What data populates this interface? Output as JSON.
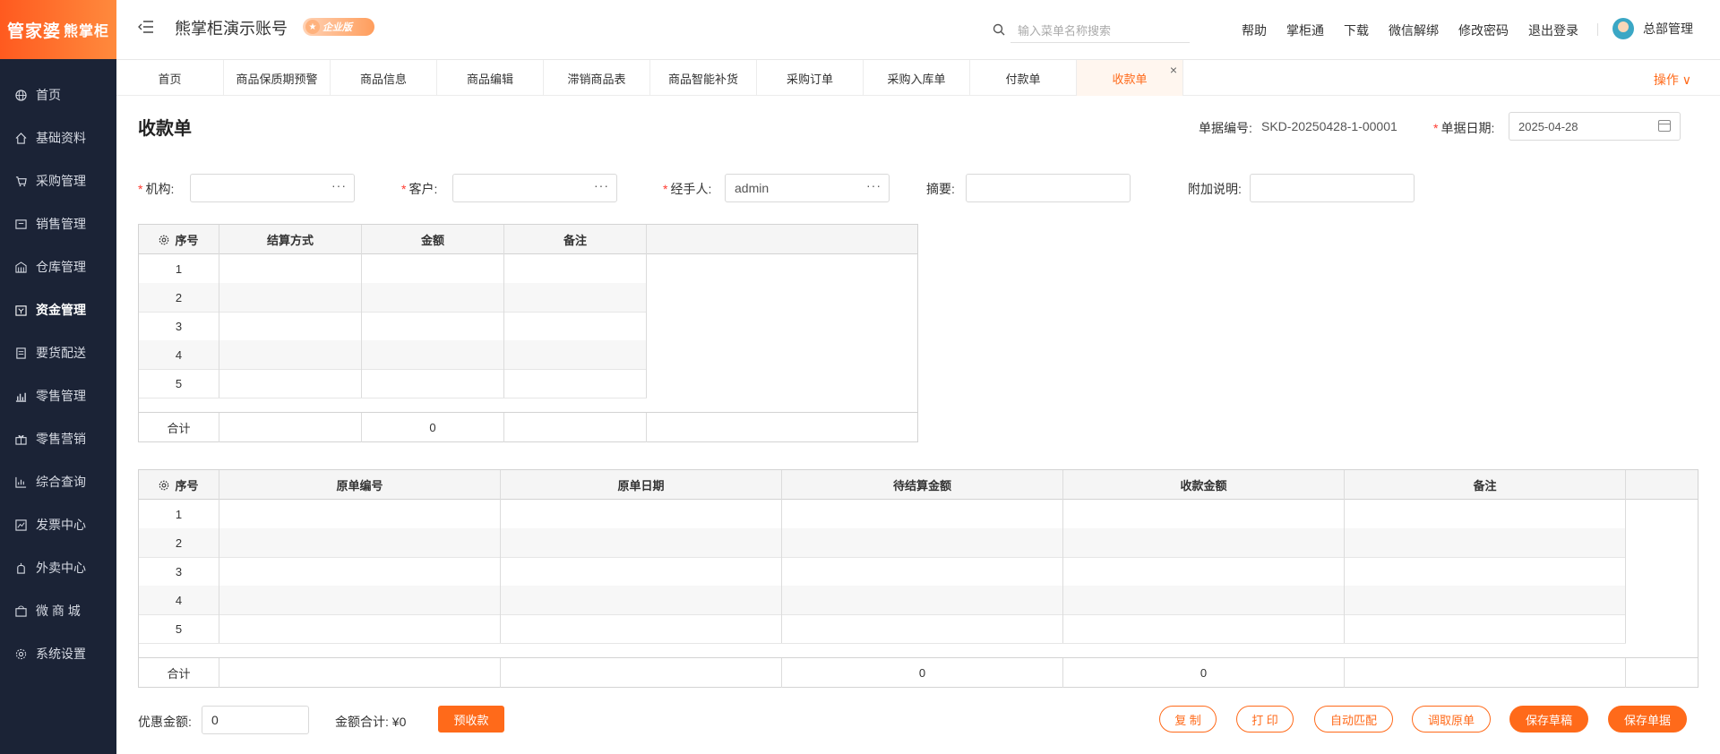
{
  "sidebar": {
    "logo_main": "管家婆",
    "logo_sub": "熊掌柜",
    "items": [
      {
        "label": "首页",
        "icon": "globe-icon"
      },
      {
        "label": "基础资料",
        "icon": "home-icon"
      },
      {
        "label": "采购管理",
        "icon": "cart-icon"
      },
      {
        "label": "销售管理",
        "icon": "sales-icon"
      },
      {
        "label": "仓库管理",
        "icon": "warehouse-icon"
      },
      {
        "label": "资金管理",
        "icon": "finance-icon"
      },
      {
        "label": "要货配送",
        "icon": "delivery-icon"
      },
      {
        "label": "零售管理",
        "icon": "retail-icon"
      },
      {
        "label": "零售营销",
        "icon": "gift-icon"
      },
      {
        "label": "综合查询",
        "icon": "chart-icon"
      },
      {
        "label": "发票中心",
        "icon": "invoice-icon"
      },
      {
        "label": "外卖中心",
        "icon": "takeout-icon"
      },
      {
        "label": "微 商 城",
        "icon": "shop-icon"
      },
      {
        "label": "系统设置",
        "icon": "gear-icon"
      }
    ],
    "active": "资金管理"
  },
  "header": {
    "account": "熊掌柜演示账号",
    "edition": "企业版",
    "search_placeholder": "输入菜单名称搜索",
    "links": [
      "帮助",
      "掌柜通",
      "下载",
      "微信解绑",
      "修改密码",
      "退出登录"
    ],
    "user": "总部管理"
  },
  "tabs": {
    "items": [
      "首页",
      "商品保质期预警",
      "商品信息",
      "商品编辑",
      "滞销商品表",
      "商品智能补货",
      "采购订单",
      "采购入库单",
      "付款单",
      "收款单"
    ],
    "active": "收款单",
    "ops": "操作 ∨"
  },
  "form": {
    "title": "收款单",
    "doc_no_label": "单据编号:",
    "doc_no": "SKD-20250428-1-00001",
    "doc_date_label": "单据日期:",
    "doc_date": "2025-04-28",
    "org_label": "机构:",
    "org": "",
    "customer_label": "客户:",
    "customer": "",
    "handler_label": "经手人:",
    "handler": "admin",
    "summary_label": "摘要:",
    "summary": "",
    "note_label": "附加说明:",
    "note": ""
  },
  "table1": {
    "columns": [
      "序号",
      "结算方式",
      "金额",
      "备注"
    ],
    "rows": [
      "1",
      "2",
      "3",
      "4",
      "5"
    ],
    "total_label": "合计",
    "total_amount": "0"
  },
  "table2": {
    "columns": [
      "序号",
      "原单编号",
      "原单日期",
      "待结算金额",
      "收款金额",
      "备注"
    ],
    "rows": [
      "1",
      "2",
      "3",
      "4",
      "5"
    ],
    "total_label": "合计",
    "total_pending": "0",
    "total_received": "0"
  },
  "footer": {
    "discount_label": "优惠金额:",
    "discount_value": "0",
    "sum_label": "金额合计: ¥0",
    "prepay": "预收款",
    "buttons": [
      "复 制",
      "打 印",
      "自动匹配",
      "调取原单",
      "保存草稿",
      "保存单据"
    ]
  },
  "colors": {
    "accent": "#ff6a1a",
    "sidebar": "#1b2336"
  }
}
